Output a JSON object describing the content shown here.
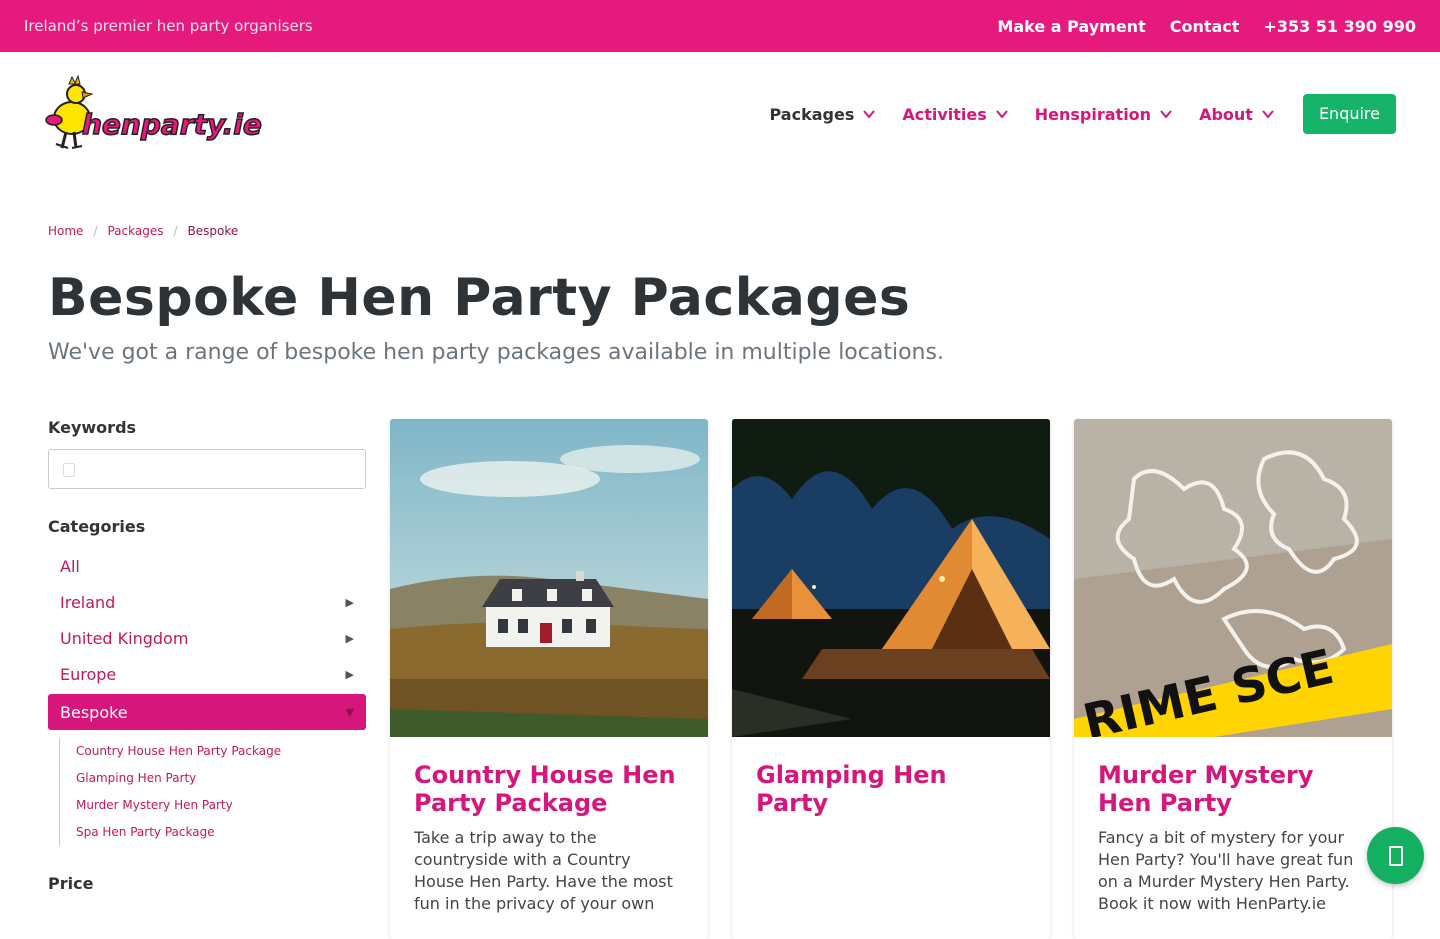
{
  "topbar": {
    "tagline": "Ireland’s premier hen party organisers",
    "payment": "Make a Payment",
    "contact": "Contact",
    "phone": "+353 51 390 990"
  },
  "logo": {
    "text": "henparty.ie"
  },
  "nav": {
    "packages": "Packages",
    "activities": "Activities",
    "henspiration": "Henspiration",
    "about": "About",
    "enquire": "Enquire"
  },
  "breadcrumb": {
    "home": "Home",
    "packages": "Packages",
    "current": "Bespoke"
  },
  "page": {
    "title": "Bespoke Hen Party Packages",
    "subtitle": "We've got a range of bespoke hen party packages available in multiple locations."
  },
  "sidebar": {
    "keywords_label": "Keywords",
    "keywords_value": "",
    "categories_label": "Categories",
    "categories": [
      "All",
      "Ireland",
      "United Kingdom",
      "Europe",
      "Bespoke"
    ],
    "sub_items": [
      "Country House Hen Party Package",
      "Glamping Hen Party",
      "Murder Mystery Hen Party",
      "Spa Hen Party Package"
    ],
    "price_label": "Price"
  },
  "cards": [
    {
      "title": "Country House Hen Party Package",
      "desc": "Take a trip away to the countryside with a Country House Hen Party. Have the most fun in the privacy of your own"
    },
    {
      "title": "Glamping Hen Party",
      "desc": ""
    },
    {
      "title": "Murder Mystery Hen Party",
      "desc": "Fancy a bit of mystery for your Hen Party? You'll have great fun on a Murder Mystery Hen Party. Book it now with HenParty.ie"
    }
  ],
  "images": {
    "tape_text": "RIME SCE"
  },
  "colors": {
    "brand_pink": "#e6197c",
    "link_pink": "#d6167a",
    "enquire_green": "#16b36b",
    "chat_green": "#12b060"
  }
}
